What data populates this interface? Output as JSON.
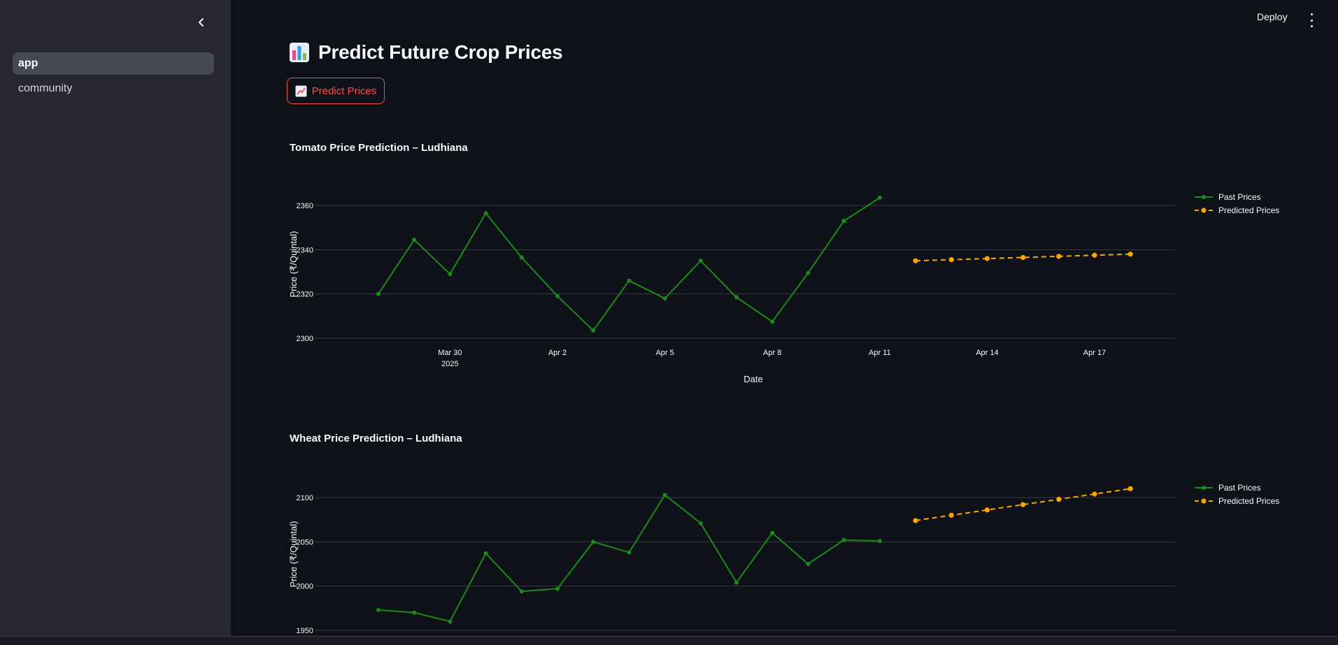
{
  "sidebar": {
    "items": [
      {
        "label": "app",
        "active": true
      },
      {
        "label": "community",
        "active": false
      }
    ],
    "collapse_icon": "chevron-left-icon"
  },
  "topbar": {
    "deploy_label": "Deploy",
    "menu_icon": "kebab-menu-icon"
  },
  "header": {
    "title": "Predict Future Crop Prices",
    "title_icon": "bar-chart-emoji-icon"
  },
  "predict_button": {
    "label": "Predict Prices",
    "icon": "chart-increasing-emoji-icon"
  },
  "colors": {
    "background": "#0e1117",
    "sidebar": "#262730",
    "accent": "#ff4b4b",
    "past_series": "#1a8a1a",
    "predicted_series": "#ffa500"
  },
  "chart_data": [
    {
      "type": "line",
      "title": "Tomato Price Prediction – Ludhiana",
      "xlabel": "Date",
      "ylabel": "Price (₹/Quintal)",
      "x_tick_labels": [
        "Mar 30\n2025",
        "Apr 2",
        "Apr 5",
        "Apr 8",
        "Apr 11",
        "Apr 14",
        "Apr 17"
      ],
      "y_ticks": [
        2300,
        2320,
        2340,
        2360
      ],
      "ylim": [
        2298,
        2366
      ],
      "legend_position": "top-right",
      "grid": true,
      "series": [
        {
          "name": "Past Prices",
          "style": "solid",
          "x": [
            "2025-03-28",
            "2025-03-29",
            "2025-03-30",
            "2025-03-31",
            "2025-04-01",
            "2025-04-02",
            "2025-04-03",
            "2025-04-04",
            "2025-04-05",
            "2025-04-06",
            "2025-04-07",
            "2025-04-08",
            "2025-04-09",
            "2025-04-10",
            "2025-04-11"
          ],
          "values": [
            2320,
            2344.5,
            2329,
            2356.5,
            2336.5,
            2319,
            2303.5,
            2326,
            2318,
            2335,
            2318.5,
            2307.5,
            2329.5,
            2353,
            2363.5
          ]
        },
        {
          "name": "Predicted Prices",
          "style": "dashed",
          "x": [
            "2025-04-12",
            "2025-04-13",
            "2025-04-14",
            "2025-04-15",
            "2025-04-16",
            "2025-04-17",
            "2025-04-18"
          ],
          "values": [
            2335,
            2335.5,
            2336,
            2336.5,
            2337,
            2337.5,
            2338
          ]
        }
      ]
    },
    {
      "type": "line",
      "title": "Wheat Price Prediction – Ludhiana",
      "xlabel": "",
      "ylabel": "Price (₹/Quintal)",
      "y_ticks": [
        1950,
        2000,
        2050,
        2100
      ],
      "ylim": [
        1950,
        2110
      ],
      "legend_position": "top-right",
      "grid": true,
      "series": [
        {
          "name": "Past Prices",
          "style": "solid",
          "x": [
            "2025-03-28",
            "2025-03-29",
            "2025-03-30",
            "2025-03-31",
            "2025-04-01",
            "2025-04-02",
            "2025-04-03",
            "2025-04-04",
            "2025-04-05",
            "2025-04-06",
            "2025-04-07",
            "2025-04-08",
            "2025-04-09",
            "2025-04-10",
            "2025-04-11"
          ],
          "values": [
            1973,
            1970,
            1960,
            2037,
            1994,
            1997,
            2050,
            2038,
            2103,
            2071,
            2004,
            2060,
            2025,
            2052,
            2051
          ]
        },
        {
          "name": "Predicted Prices",
          "style": "dashed",
          "x": [
            "2025-04-12",
            "2025-04-13",
            "2025-04-14",
            "2025-04-15",
            "2025-04-16",
            "2025-04-17",
            "2025-04-18"
          ],
          "values": [
            2074,
            2080,
            2086,
            2092,
            2098,
            2104,
            2110
          ]
        }
      ]
    }
  ]
}
